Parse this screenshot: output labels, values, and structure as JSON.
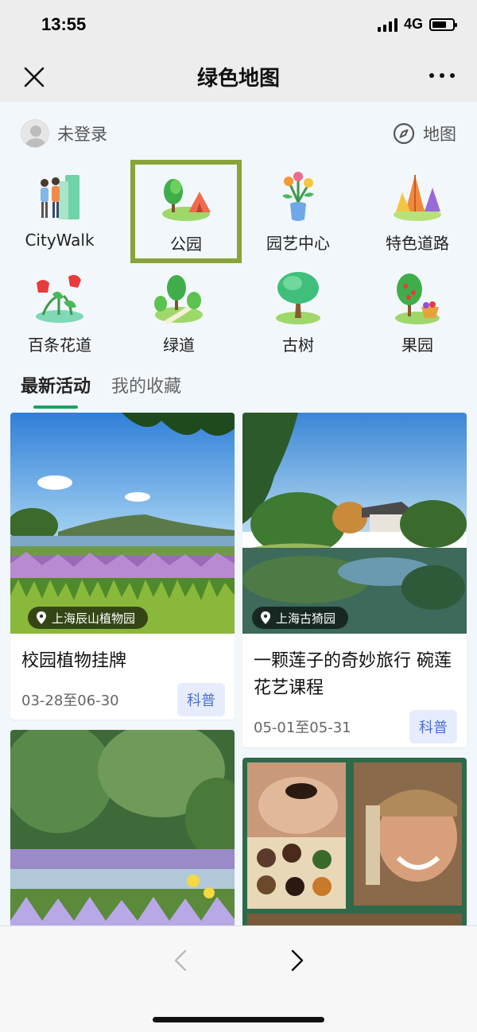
{
  "status": {
    "time": "13:55",
    "network": "4G"
  },
  "nav": {
    "title": "绿色地图"
  },
  "user": {
    "login_label": "未登录",
    "map_label": "地图"
  },
  "categories": [
    {
      "label": "CityWalk",
      "icon": "people-walking-icon"
    },
    {
      "label": "公园",
      "icon": "park-tent-icon",
      "selected": true
    },
    {
      "label": "园艺中心",
      "icon": "flower-vase-icon"
    },
    {
      "label": "特色道路",
      "icon": "autumn-tree-icon"
    },
    {
      "label": "百条花道",
      "icon": "tulip-flowers-icon"
    },
    {
      "label": "绿道",
      "icon": "green-path-icon"
    },
    {
      "label": "古树",
      "icon": "old-tree-icon"
    },
    {
      "label": "果园",
      "icon": "fruit-tree-icon"
    }
  ],
  "tabs": [
    {
      "label": "最新活动",
      "active": true
    },
    {
      "label": "我的收藏",
      "active": false
    }
  ],
  "activities": [
    {
      "location": "上海辰山植物园",
      "title": "校园植物挂牌",
      "date": "03-28至06-30",
      "tag": "科普"
    },
    {
      "location": "上海古猗园",
      "title": "一颗莲子的奇妙旅行 碗莲花艺课程",
      "date": "05-01至05-31",
      "tag": "科普"
    }
  ],
  "colors": {
    "accent": "#1aa06a",
    "selected_border": "#8aa33a",
    "tag_bg": "#e6ecfb",
    "tag_text": "#4d6fd2"
  }
}
